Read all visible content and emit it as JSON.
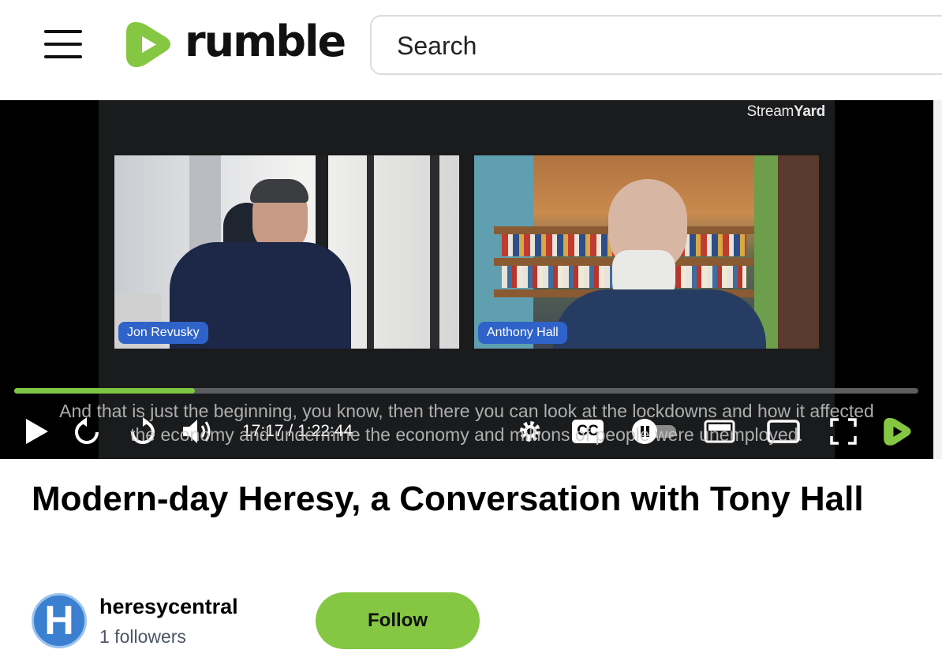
{
  "header": {
    "logo_text": "rumble",
    "search_placeholder": "Search"
  },
  "video": {
    "watermark_light": "Stream",
    "watermark_bold": "Yard",
    "participants": [
      {
        "name": "Jon Revusky"
      },
      {
        "name": "Anthony Hall"
      }
    ],
    "caption_line1": "And that is just the beginning, you know, then there you can look at the lockdowns and how it affected",
    "caption_line2": "the economy and undermine the economy and millions of people were unemployed.",
    "time_display": "17:17 / 1:22:44",
    "progress_fraction": 0.2,
    "accent_color": "#7ec545"
  },
  "controls": {
    "icons": [
      "play-icon",
      "rewind-icon",
      "forward-icon",
      "volume-icon",
      "settings-icon",
      "cc-icon",
      "autoplay-toggle-icon",
      "miniplayer-icon",
      "theater-icon",
      "fullscreen-icon",
      "rumble-logo-icon"
    ],
    "cc_label": "CC"
  },
  "main": {
    "title": "Modern-day Heresy, a Conversation with Tony Hall",
    "channel": {
      "avatar_letter": "H",
      "name": "heresycentral",
      "followers": "1 followers"
    },
    "follow_label": "Follow",
    "follow_color": "#85c742"
  }
}
